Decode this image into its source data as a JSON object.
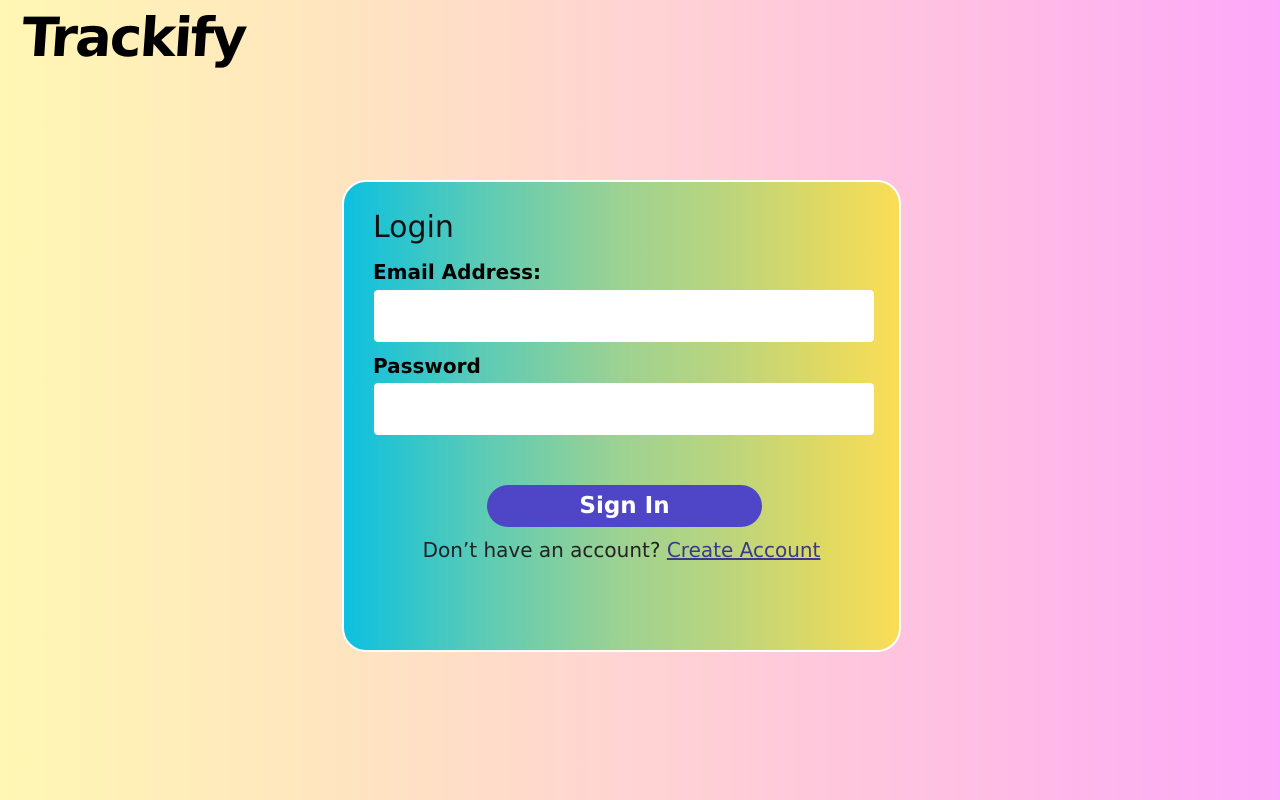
{
  "brand": {
    "logo_text": "Trackify"
  },
  "login": {
    "title": "Login",
    "email_label": "Email Address:",
    "email_value": "",
    "email_placeholder": "",
    "password_label": "Password",
    "password_value": "",
    "password_placeholder": "",
    "signin_label": "Sign In",
    "signup_prompt": "Don’t have an account?",
    "create_account_label": "Create Account"
  },
  "colors": {
    "background_left": "#fff7b3",
    "background_right": "#fea7f9",
    "card_left": "#0cc0df",
    "card_right": "#fbdd55",
    "button": "#4e46c6",
    "link": "#3b3a8a"
  }
}
